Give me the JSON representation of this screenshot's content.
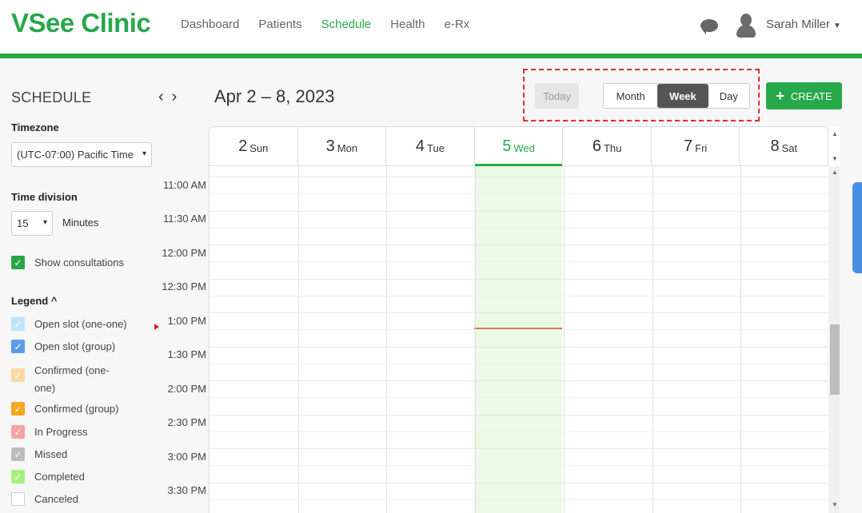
{
  "brand": "VSee Clinic",
  "nav": {
    "items": [
      {
        "label": "Dashboard",
        "active": false
      },
      {
        "label": "Patients",
        "active": false
      },
      {
        "label": "Schedule",
        "active": true
      },
      {
        "label": "Health",
        "active": false
      },
      {
        "label": "e-Rx",
        "active": false
      }
    ],
    "user_name": "Sarah Miller"
  },
  "colors": {
    "brand_green": "#27a84a",
    "today_column": "#eafae4",
    "now_line": "#e2735f",
    "highlight_box": "#d9302c"
  },
  "sidebar": {
    "title": "SCHEDULE",
    "timezone_label": "Timezone",
    "timezone_value": "(UTC-07:00) Pacific Time",
    "time_division_label": "Time division",
    "time_division_value": "15",
    "minutes_label": "Minutes",
    "show_consultations_label": "Show consultations",
    "show_consultations_checked": true,
    "legend_title": "Legend ^",
    "legend": [
      {
        "label": "Open slot (one-one)",
        "color": "#bfe3fb",
        "checked": true
      },
      {
        "label": "Open slot (group)",
        "color": "#5b9bea",
        "checked": true
      },
      {
        "label": "Confirmed (one-one)",
        "color": "#fbd9a4",
        "checked": true
      },
      {
        "label": "Confirmed (group)",
        "color": "#f5a623",
        "checked": true
      },
      {
        "label": "In Progress",
        "color": "#f7a3a3",
        "checked": true
      },
      {
        "label": "Missed",
        "color": "#bdbdbd",
        "checked": true
      },
      {
        "label": "Completed",
        "color": "#a8f07e",
        "checked": true
      },
      {
        "label": "Canceled",
        "color": "#ffffff",
        "checked": false
      }
    ]
  },
  "toolbar": {
    "prev_icon": "‹",
    "next_icon": "›",
    "date_range": "Apr 2 – 8, 2023",
    "today_label": "Today",
    "views": [
      "Month",
      "Week",
      "Day"
    ],
    "active_view": "Week",
    "create_label": "CREATE"
  },
  "calendar": {
    "days": [
      {
        "num": "2",
        "name": "Sun",
        "today": false
      },
      {
        "num": "3",
        "name": "Mon",
        "today": false
      },
      {
        "num": "4",
        "name": "Tue",
        "today": false
      },
      {
        "num": "5",
        "name": "Wed",
        "today": true
      },
      {
        "num": "6",
        "name": "Thu",
        "today": false
      },
      {
        "num": "7",
        "name": "Fri",
        "today": false
      },
      {
        "num": "8",
        "name": "Sat",
        "today": false
      }
    ],
    "times": [
      "11:00 AM",
      "11:30 AM",
      "12:00 PM",
      "12:30 PM",
      "1:00 PM",
      "1:30 PM",
      "2:00 PM",
      "2:30 PM",
      "3:00 PM",
      "3:30 PM"
    ]
  }
}
